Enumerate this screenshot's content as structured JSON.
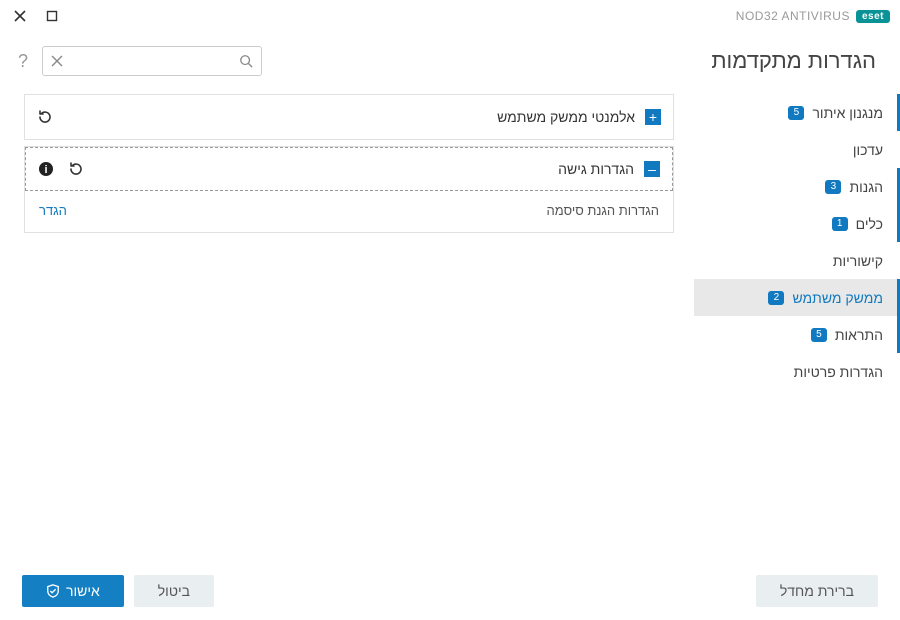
{
  "brand": {
    "badge": "eset",
    "product": "NOD32 ANTIVIRUS"
  },
  "page_title": "הגדרות מתקדמות",
  "search": {
    "placeholder": "",
    "value": ""
  },
  "help_glyph": "?",
  "sidebar": {
    "items": [
      {
        "label": "מנגנון איתור",
        "badge": "5",
        "active": false
      },
      {
        "label": "עדכון",
        "badge": "",
        "active": false
      },
      {
        "label": "הגנות",
        "badge": "3",
        "active": false
      },
      {
        "label": "כלים",
        "badge": "1",
        "active": false
      },
      {
        "label": "קישוריות",
        "badge": "",
        "active": false
      },
      {
        "label": "ממשק משתמש",
        "badge": "2",
        "active": true
      },
      {
        "label": "התראות",
        "badge": "5",
        "active": false
      },
      {
        "label": "הגדרות פרטיות",
        "badge": "",
        "active": false
      }
    ]
  },
  "panels": {
    "p0": {
      "title": "אלמנטי ממשק משתמש",
      "expanded": false
    },
    "p1": {
      "title": "הגדרות גישה",
      "expanded": true,
      "row": {
        "label": "הגדרות הגנת סיסמה",
        "action": "הגדר"
      }
    }
  },
  "footer": {
    "default_btn": "ברירת מחדל",
    "ok_btn": "אישור",
    "cancel_btn": "ביטול"
  }
}
